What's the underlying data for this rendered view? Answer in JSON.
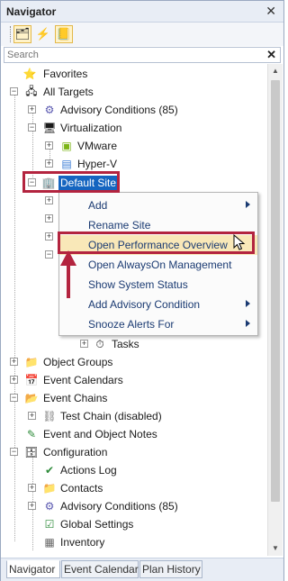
{
  "window": {
    "title": "Navigator",
    "close_glyph": "✕"
  },
  "toolbar": {
    "buttons": [
      {
        "icon": "targets-icon",
        "glyph": "🗂",
        "active": true
      },
      {
        "icon": "lightning-icon",
        "glyph": "⚡",
        "active": false
      },
      {
        "icon": "notes-icon",
        "glyph": "📒",
        "active": true
      }
    ]
  },
  "search": {
    "placeholder": "Search",
    "clear_glyph": "✕"
  },
  "tree": {
    "favorites": "Favorites",
    "all_targets": "All Targets",
    "advisory_conditions": "Advisory Conditions (85)",
    "virtualization": "Virtualization",
    "vmware": "VMware",
    "hyperv": "Hyper-V",
    "default_site": "Default Site",
    "tasks": "Tasks",
    "object_groups": "Object Groups",
    "event_calendars": "Event Calendars",
    "event_chains": "Event Chains",
    "test_chain": "Test Chain (disabled)",
    "event_object_notes": "Event and Object Notes",
    "configuration": "Configuration",
    "actions_log": "Actions Log",
    "contacts": "Contacts",
    "config_advisory": "Advisory Conditions (85)",
    "global_settings": "Global Settings",
    "inventory": "Inventory"
  },
  "context_menu": {
    "items": [
      {
        "label": "Add",
        "submenu": true
      },
      {
        "label": "Rename Site",
        "submenu": false
      },
      {
        "label": "Open Performance Overview",
        "submenu": false,
        "highlighted": true
      },
      {
        "label": "Open AlwaysOn Management",
        "submenu": false
      },
      {
        "label": "Show System Status",
        "submenu": false
      },
      {
        "label": "Add Advisory Condition",
        "submenu": true
      },
      {
        "label": "Snooze Alerts For",
        "submenu": true
      }
    ]
  },
  "tabs": [
    {
      "label": "Navigator",
      "active": true
    },
    {
      "label": "Event Calendar",
      "active": false
    },
    {
      "label": "Plan History",
      "active": false
    }
  ],
  "colors": {
    "selection": "#1565c0",
    "highlight_box": "#b3243f",
    "menu_hover": "#f9e8b8"
  }
}
